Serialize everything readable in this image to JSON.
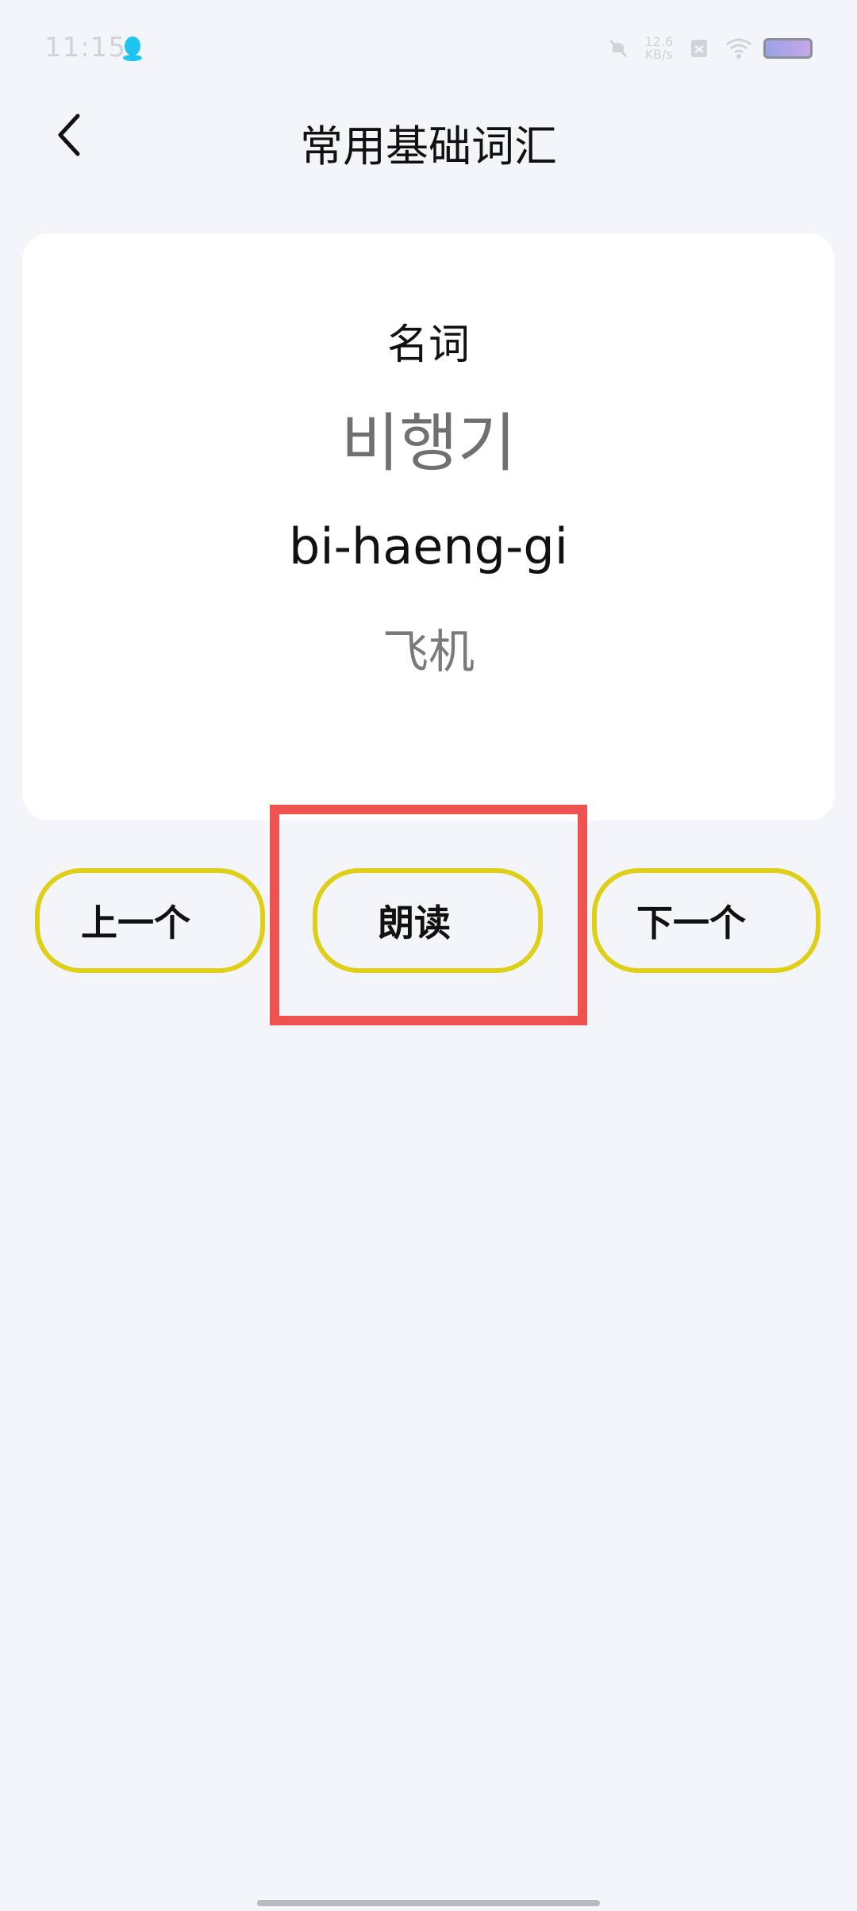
{
  "status_bar": {
    "time": "11:15",
    "net_speed_value": "12.6",
    "net_speed_unit": "KB/s",
    "icons": [
      "qq-icon",
      "mute-icon",
      "sim-icon",
      "wifi-icon",
      "battery-icon"
    ]
  },
  "header": {
    "title": "常用基础词汇",
    "back_icon": "chevron-left-icon"
  },
  "card": {
    "part_of_speech": "名词",
    "korean": "비행기",
    "romanization": "bi-haeng-gi",
    "translation": "飞机"
  },
  "controls": {
    "prev_label": "上一个",
    "read_label": "朗读",
    "next_label": "下一个"
  },
  "colors": {
    "background": "#f3f5f9",
    "button_border": "#e0cf18",
    "highlight": "#ef5350"
  }
}
